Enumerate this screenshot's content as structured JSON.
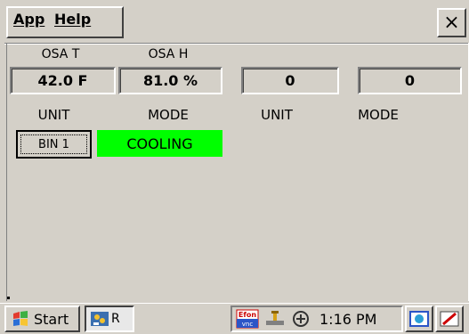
{
  "menu": {
    "app": "App",
    "help": "Help",
    "close": "×"
  },
  "sensors": [
    {
      "label": "OSA T",
      "value": "42.0 F"
    },
    {
      "label": "OSA H",
      "value": "81.0 %"
    },
    {
      "label": "",
      "value": "0"
    },
    {
      "label": "",
      "value": "0"
    }
  ],
  "headers": [
    "UNIT",
    "MODE",
    "UNIT",
    "MODE"
  ],
  "unit_button": "BIN 1",
  "mode_status": {
    "text": "COOLING",
    "color": "#00ff00"
  },
  "taskbar": {
    "start": "Start",
    "task_label": "R",
    "tray_vnc": "Efon vnc",
    "clock": "1:16 PM"
  }
}
